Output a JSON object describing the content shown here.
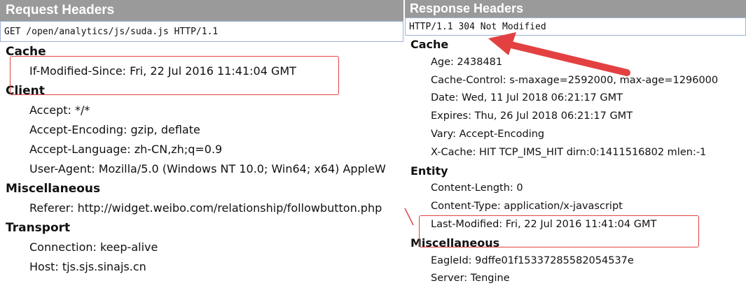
{
  "request": {
    "title": "Request Headers",
    "status_line": "GET /open/analytics/js/suda.js HTTP/1.1",
    "sections": [
      {
        "title": "Cache",
        "rows": [
          "If-Modified-Since: Fri, 22 Jul 2016 11:41:04 GMT"
        ]
      },
      {
        "title": "Client",
        "rows": [
          "Accept: */*",
          "Accept-Encoding: gzip, deflate",
          "Accept-Language: zh-CN,zh;q=0.9",
          "User-Agent: Mozilla/5.0 (Windows NT 10.0; Win64; x64) AppleW"
        ]
      },
      {
        "title": "Miscellaneous",
        "rows": [
          "Referer: http://widget.weibo.com/relationship/followbutton.php"
        ]
      },
      {
        "title": "Transport",
        "rows": [
          "Connection: keep-alive",
          "Host: tjs.sjs.sinajs.cn"
        ]
      }
    ]
  },
  "response": {
    "title": "Response Headers",
    "status_line": "HTTP/1.1 304 Not Modified",
    "sections": [
      {
        "title": "Cache",
        "rows": [
          "Age: 2438481",
          "Cache-Control: s-maxage=2592000, max-age=1296000",
          "Date: Wed, 11 Jul 2018 06:21:17 GMT",
          "Expires: Thu, 26 Jul 2018 06:21:17 GMT",
          "Vary: Accept-Encoding",
          "X-Cache: HIT TCP_IMS_HIT dirn:0:1411516802 mlen:-1"
        ]
      },
      {
        "title": "Entity",
        "rows": [
          "Content-Length: 0",
          "Content-Type: application/x-javascript",
          "Last-Modified: Fri, 22 Jul 2016 11:41:04 GMT"
        ]
      },
      {
        "title": "Miscellaneous",
        "rows": [
          "EagleId: 9dffe01f15337285582054537e",
          "Server: Tengine"
        ]
      }
    ]
  },
  "colors": {
    "header_bg": "#9a9a9a",
    "annotation_red": "#e34141",
    "status_border": "#9bb4d3"
  }
}
